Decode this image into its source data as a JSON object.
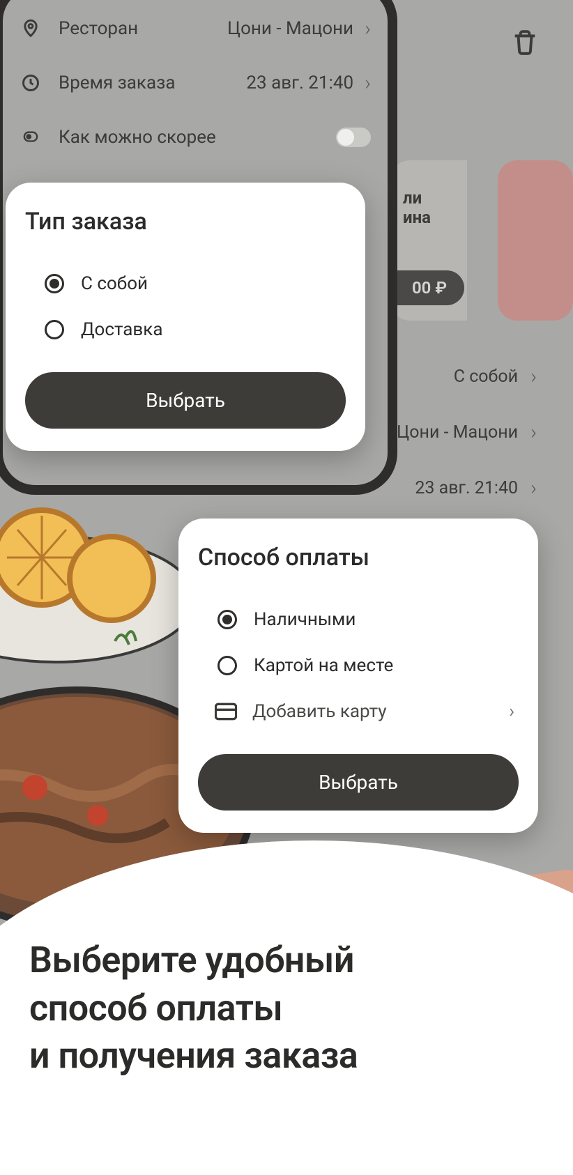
{
  "phone1_bg": {
    "restaurant_label": "Ресторан",
    "restaurant_value": "Цони - Мацони",
    "time_label": "Время заказа",
    "time_value": "23 авг. 21:40",
    "asap_label": "Как можно скорее"
  },
  "modal1": {
    "title": "Тип заказа",
    "option1": "С собой",
    "option2": "Доставка",
    "button": "Выбрать"
  },
  "phone2_bg": {
    "product_text1": "ли",
    "product_text2": "ина",
    "price_fragment": "00 ₽",
    "summary_type": "С собой",
    "summary_restaurant": "Цони - Мацони",
    "summary_time": "23 авг. 21:40"
  },
  "modal2": {
    "title": "Способ оплаты",
    "option1": "Наличными",
    "option2": "Картой на месте",
    "add_card": "Добавить карту",
    "button": "Выбрать"
  },
  "heading": {
    "line1": "Выберите удобный",
    "line2": "способ оплаты",
    "line3": "и получения заказа"
  }
}
